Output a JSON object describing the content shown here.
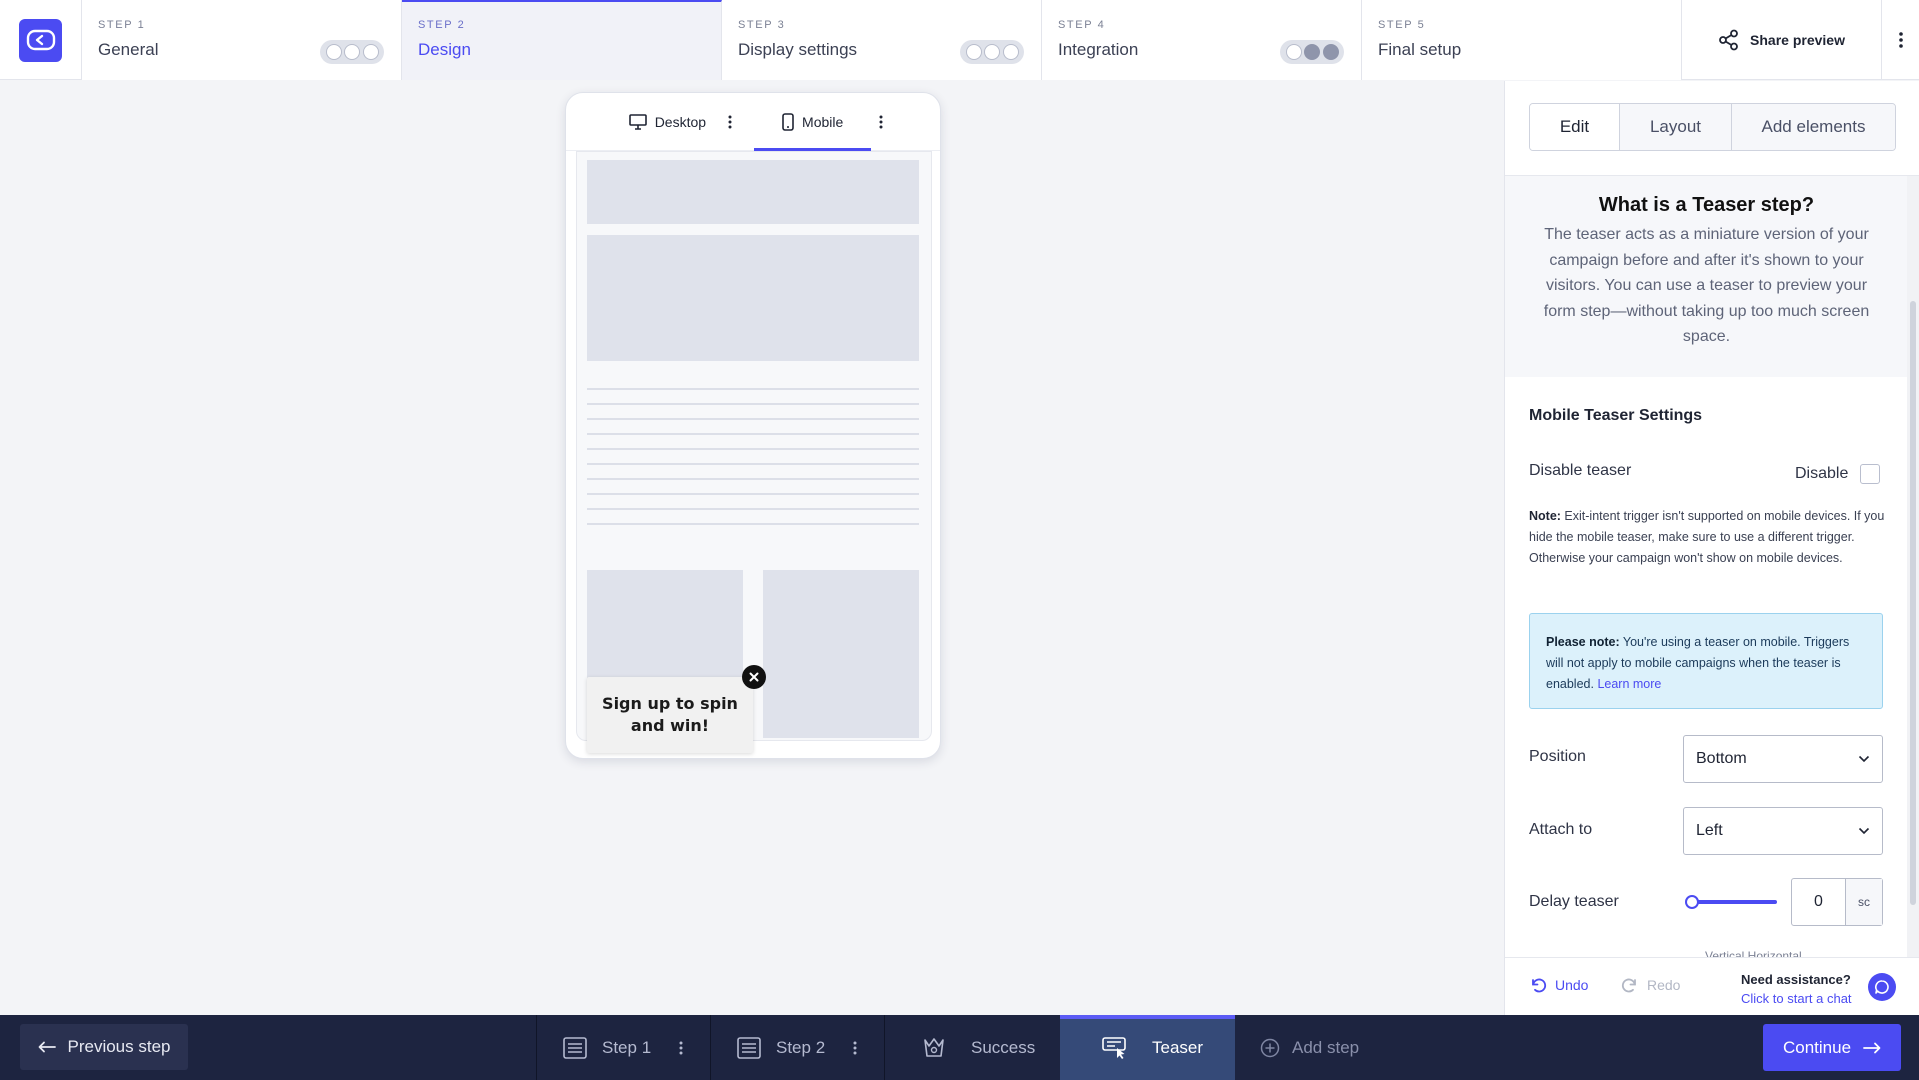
{
  "steps": [
    {
      "num": "STEP 1",
      "name": "General"
    },
    {
      "num": "STEP 2",
      "name": "Design"
    },
    {
      "num": "STEP 3",
      "name": "Display settings"
    },
    {
      "num": "STEP 4",
      "name": "Integration"
    },
    {
      "num": "STEP 5",
      "name": "Final setup"
    }
  ],
  "header": {
    "share_label": "Share preview"
  },
  "preview": {
    "desktop_label": "Desktop",
    "mobile_label": "Mobile",
    "teaser_text": "Sign up to spin and win!"
  },
  "panel": {
    "tabs": [
      "Edit",
      "Layout",
      "Add elements"
    ],
    "info_title": "What is a Teaser step?",
    "info_body": "The teaser acts as a miniature version of your campaign before and after it's shown to your visitors. You can use a teaser to preview your form step—without taking up too much screen space.",
    "section_title": "Mobile Teaser Settings",
    "disable_teaser_label": "Disable teaser",
    "disable_label": "Disable",
    "note_prefix": "Note:",
    "note_text": " Exit-intent trigger isn't supported on mobile devices. If you hide the mobile teaser, make sure to use a different trigger. Otherwise your campaign won't show on mobile devices.",
    "callout_prefix": "Please note:",
    "callout_text": " You're using a teaser on mobile. Triggers will not apply to mobile campaigns when the teaser is enabled. ",
    "callout_link": "Learn more",
    "position_label": "Position",
    "position_value": "Bottom",
    "attach_label": "Attach to",
    "attach_value": "Left",
    "delay_label": "Delay teaser",
    "delay_value": "0",
    "delay_unit": "sc",
    "cut_text": "Vertical        Horizontal",
    "undo_label": "Undo",
    "redo_label": "Redo",
    "assist_title": "Need assistance?",
    "assist_link": "Click to start a chat"
  },
  "bottom": {
    "prev_label": "Previous step",
    "tabs": [
      "Step 1",
      "Step 2",
      "Success",
      "Teaser",
      "Add step"
    ],
    "continue_label": "Continue"
  },
  "colors": {
    "accent": "#4b4bf2",
    "bottom_bg": "#1d2440"
  }
}
